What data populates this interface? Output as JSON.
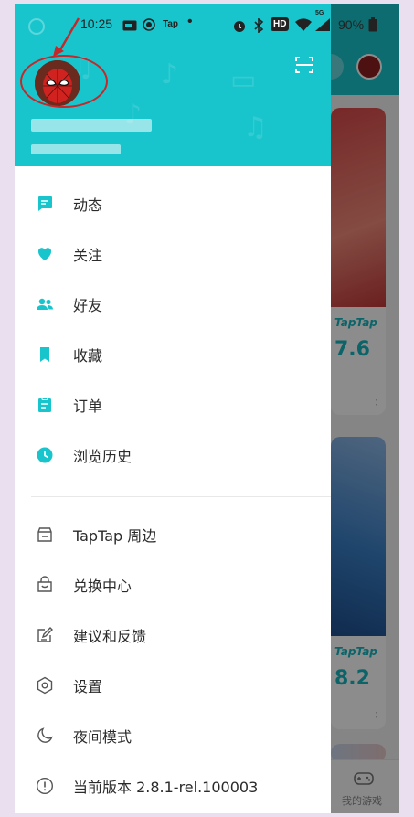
{
  "status_bar": {
    "time": "10:25",
    "tap_label": "Tap",
    "battery": "90%",
    "hd_label": "HD",
    "network_label": "5G"
  },
  "drawer": {
    "menu_primary": [
      {
        "label": "动态",
        "icon": "feed-icon"
      },
      {
        "label": "关注",
        "icon": "heart-icon"
      },
      {
        "label": "好友",
        "icon": "friends-icon"
      },
      {
        "label": "收藏",
        "icon": "bookmark-icon"
      },
      {
        "label": "订单",
        "icon": "order-icon"
      },
      {
        "label": "浏览历史",
        "icon": "clock-icon"
      }
    ],
    "menu_secondary": [
      {
        "label": "TapTap 周边",
        "icon": "store-icon"
      },
      {
        "label": "兑换中心",
        "icon": "bag-icon"
      },
      {
        "label": "建议和反馈",
        "icon": "feedback-icon"
      },
      {
        "label": "设置",
        "icon": "settings-icon"
      },
      {
        "label": "夜间模式",
        "icon": "moon-icon"
      },
      {
        "label": "当前版本 2.8.1-rel.100003",
        "icon": "info-icon"
      }
    ]
  },
  "background": {
    "cards": [
      {
        "brand": "TapTap",
        "score": "7.6"
      },
      {
        "brand": "TapTap",
        "score": "8.2"
      }
    ],
    "bottom_nav_label": "我的游戏"
  },
  "colors": {
    "accent": "#19c5cc",
    "annotation": "#c3282a"
  }
}
